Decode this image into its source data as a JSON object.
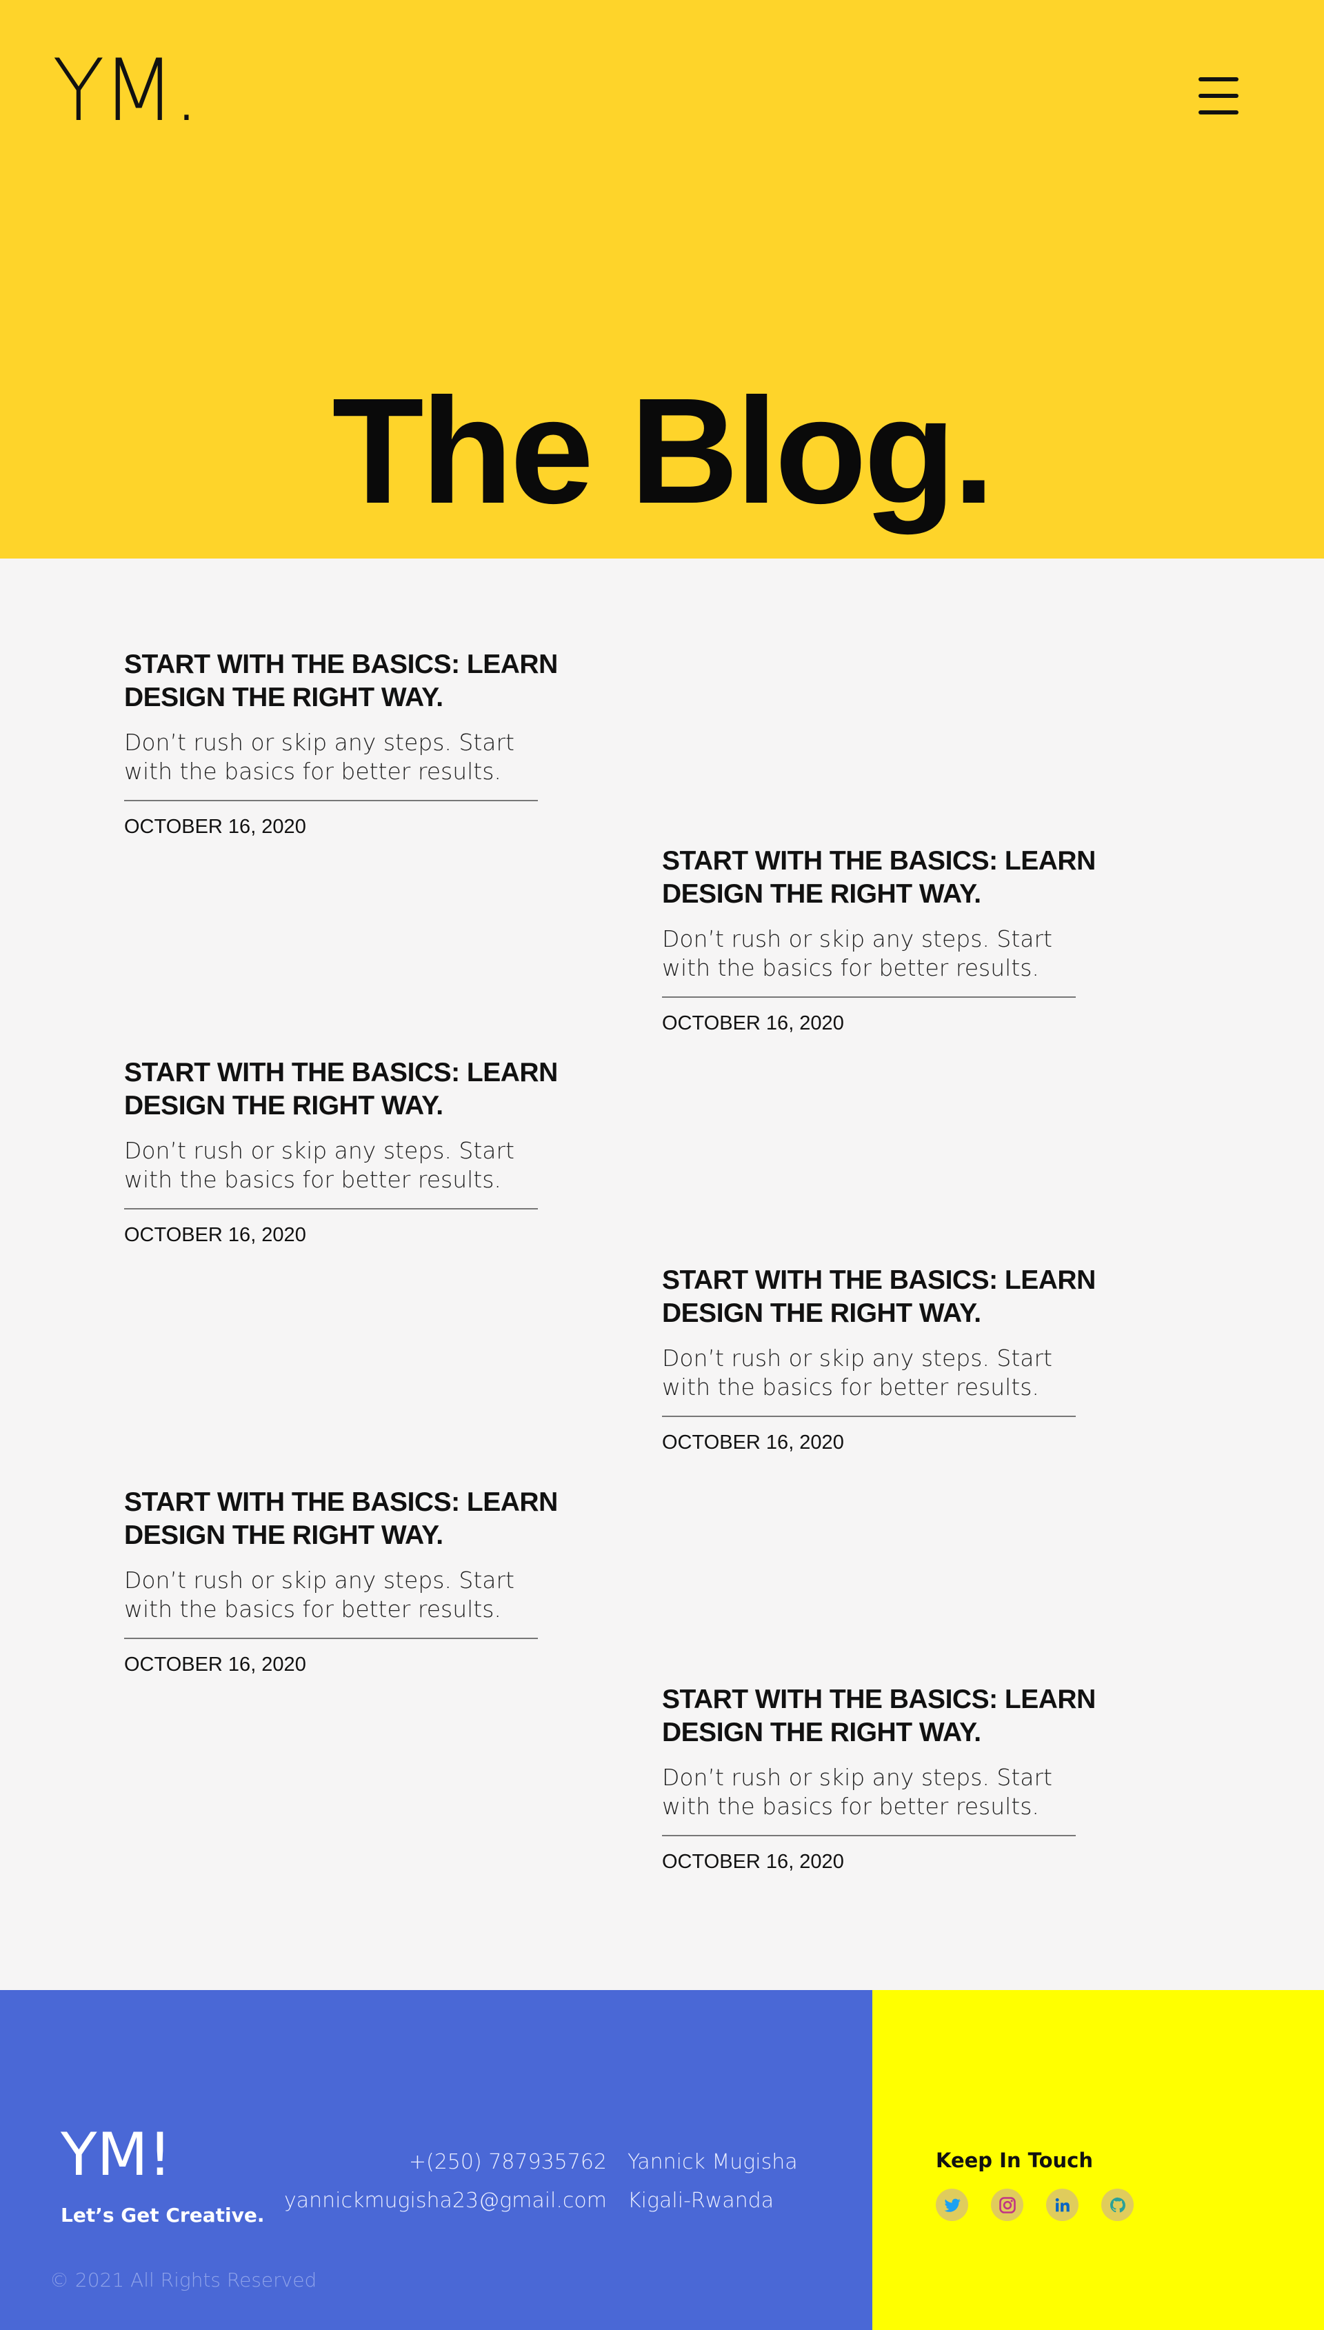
{
  "header": {
    "logo": "YM.",
    "menu_icon": "hamburger-menu-icon",
    "title": "The Blog."
  },
  "posts": [
    {
      "title": "START WITH THE BASICS: LEARN DESIGN THE RIGHT WAY.",
      "excerpt": "Don’t rush or skip any steps. Start with the basics for better results.",
      "date": "OCTOBER 16, 2020"
    },
    {
      "title": "START WITH THE BASICS: LEARN DESIGN THE RIGHT WAY.",
      "excerpt": "Don’t rush or skip any steps. Start with the basics for better results.",
      "date": "OCTOBER 16, 2020"
    },
    {
      "title": "START WITH THE BASICS: LEARN DESIGN THE RIGHT WAY.",
      "excerpt": "Don’t rush or skip any steps. Start with the basics for better results.",
      "date": "OCTOBER 16, 2020"
    },
    {
      "title": "START WITH THE BASICS: LEARN DESIGN THE RIGHT WAY.",
      "excerpt": "Don’t rush or skip any steps. Start with the basics for better results.",
      "date": "OCTOBER 16, 2020"
    },
    {
      "title": "START WITH THE BASICS: LEARN DESIGN THE RIGHT WAY.",
      "excerpt": "Don’t rush or skip any steps. Start with the basics for better results.",
      "date": "OCTOBER 16, 2020"
    },
    {
      "title": "START WITH THE BASICS: LEARN DESIGN THE RIGHT WAY.",
      "excerpt": "Don’t rush or skip any steps. Start with the basics for better results.",
      "date": "OCTOBER 16, 2020"
    }
  ],
  "footer": {
    "logo": "YM!",
    "tagline": "Let’s Get Creative.",
    "phone": "+(250) 787935762",
    "email": "yannickmugisha23@gmail.com",
    "name": "Yannick Mugisha",
    "location": "Kigali-Rwanda",
    "copyright": "© 2021 All Rights Reserved",
    "keep_in_touch": "Keep In Touch",
    "social_icons": [
      "twitter-icon",
      "instagram-icon",
      "linkedin-icon",
      "github-icon"
    ]
  },
  "colors": {
    "hero_bg": "#fed42a",
    "page_bg": "#f6f5f5",
    "footer_left_bg": "#4a68d6",
    "footer_right_bg": "#ffff00",
    "social_circle": "#e0cc5c",
    "twitter": "#1da1f2",
    "instagram": "#c13584",
    "linkedin": "#0a66c2",
    "github": "#2aa198"
  }
}
